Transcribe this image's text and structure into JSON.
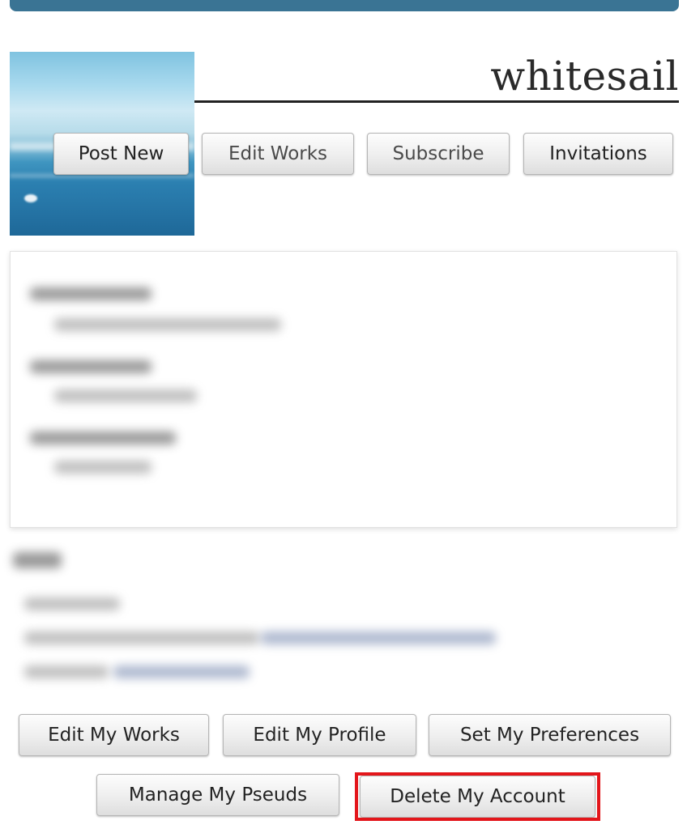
{
  "header": {
    "username": "whitesail"
  },
  "actions": {
    "post_new": "Post New",
    "edit_works": "Edit Works",
    "subscribe": "Subscribe",
    "invitations": "Invitations"
  },
  "footer_actions": {
    "edit_my_works": "Edit My Works",
    "edit_my_profile": "Edit My Profile",
    "set_my_preferences": "Set My Preferences",
    "manage_my_pseuds": "Manage My Pseuds",
    "delete_my_account": "Delete My Account"
  },
  "colors": {
    "top_bar": "#3a7494",
    "highlight": "#e3161b"
  }
}
